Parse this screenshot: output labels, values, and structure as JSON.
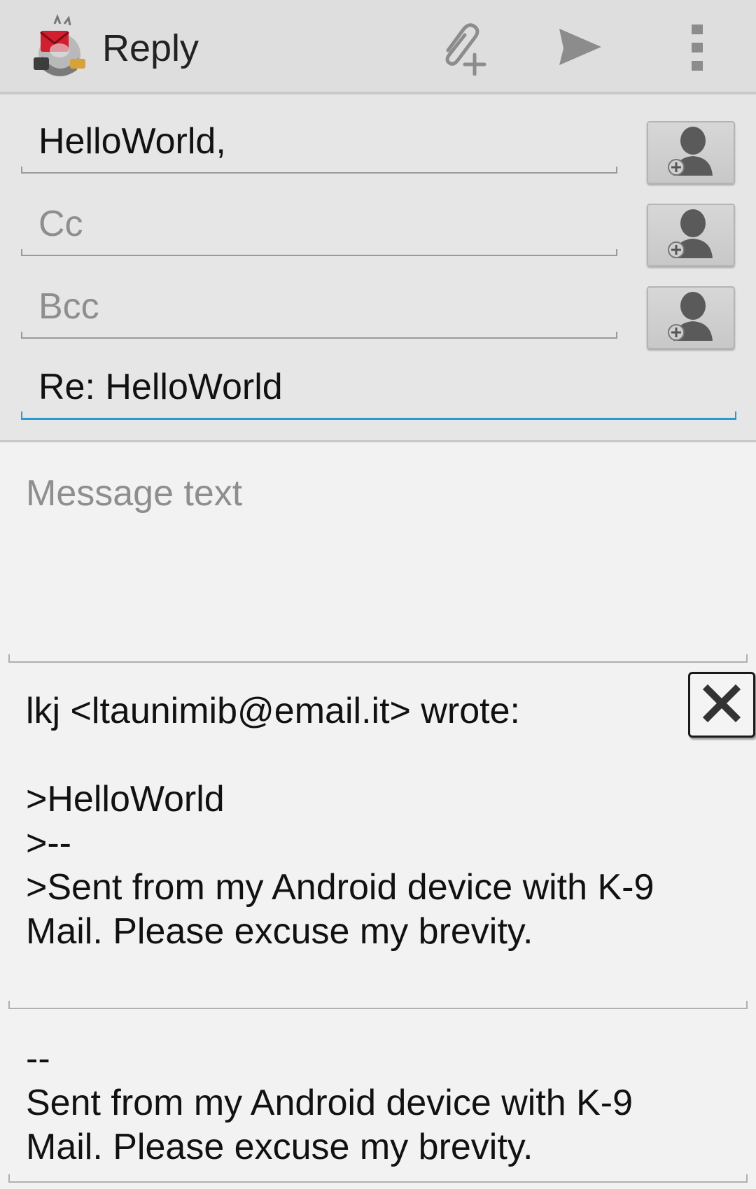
{
  "action_bar": {
    "app_icon": "k9-mail-app-icon",
    "title": "Reply",
    "actions": [
      {
        "icon": "attach-icon"
      },
      {
        "icon": "send-icon"
      },
      {
        "icon": "overflow-menu-icon"
      }
    ]
  },
  "recipients": {
    "to_value": "HelloWorld,",
    "cc_placeholder": "Cc",
    "bcc_placeholder": "Bcc",
    "add_contact_icon": "add-contact-icon"
  },
  "subject": {
    "value": "Re: HelloWorld"
  },
  "message": {
    "placeholder": "Message text"
  },
  "quoted": {
    "lines": [
      "lkj <ltaunimib@email.it> wrote:",
      "",
      ">HelloWorld",
      ">--",
      ">Sent from my Android device with K-9",
      "Mail. Please excuse my brevity."
    ],
    "remove_icon": "close-icon"
  },
  "signature": {
    "lines": [
      "--",
      "Sent from my Android device with K-9",
      "Mail. Please excuse my brevity."
    ]
  },
  "colors": {
    "accent": "#2a9bd0",
    "action_bar_bg": "#dedede",
    "header_bg": "#e6e6e6",
    "body_bg": "#f2f2f2"
  }
}
